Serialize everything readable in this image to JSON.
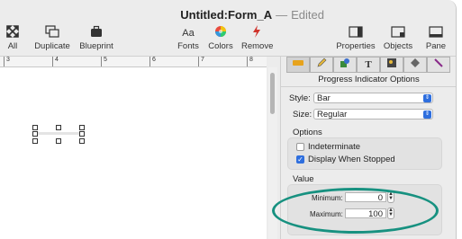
{
  "window": {
    "doc_name": "Untitled:Form_A",
    "separator": "—",
    "status": "Edited"
  },
  "toolbar": {
    "all": {
      "label": "All",
      "icon": "expand-arrows-icon"
    },
    "duplicate": {
      "label": "Duplicate",
      "icon": "duplicate-icon"
    },
    "blueprint": {
      "label": "Blueprint",
      "icon": "briefcase-icon"
    },
    "fonts": {
      "label": "Fonts",
      "icon_text": "Aa"
    },
    "colors": {
      "label": "Colors",
      "icon": "color-wheel-icon"
    },
    "remove": {
      "label": "Remove",
      "icon": "lightning-icon"
    },
    "properties": {
      "label": "Properties",
      "icon": "properties-panel-icon"
    },
    "objects": {
      "label": "Objects",
      "icon": "objects-panel-icon"
    },
    "pane": {
      "label": "Pane",
      "icon": "pane-icon"
    }
  },
  "ruler": [
    "3",
    "4",
    "5",
    "6",
    "7",
    "8"
  ],
  "inspector": {
    "title": "Progress Indicator Options",
    "style_label": "Style:",
    "style_value": "Bar",
    "size_label": "Size:",
    "size_value": "Regular",
    "options_heading": "Options",
    "indeterminate_label": "Indeterminate",
    "indeterminate_checked": false,
    "display_when_stopped_label": "Display When Stopped",
    "display_when_stopped_checked": true,
    "value_heading": "Value",
    "minimum_label": "Minimum:",
    "minimum_value": "0",
    "maximum_label": "Maximum:",
    "maximum_value": "100"
  },
  "colors": {
    "annotation": "#179180",
    "accent": "#2f6fde"
  }
}
